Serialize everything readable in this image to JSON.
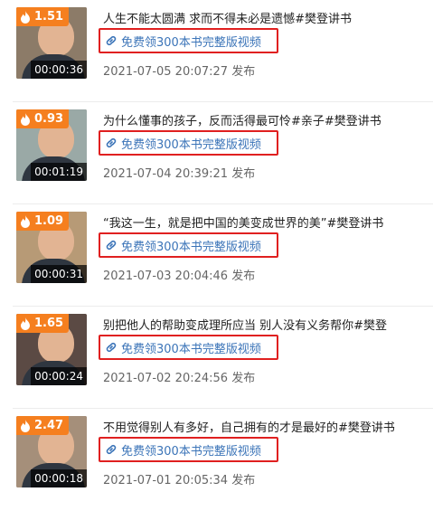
{
  "items": [
    {
      "heat": "1.51",
      "duration": "00:00:36",
      "title": "人生不能太圆满 求而不得未必是遗憾#樊登讲书",
      "link": "免费领300本书完整版视频",
      "date": "2021-07-05 20:07:27 发布",
      "thumb_color": "#8c7b68"
    },
    {
      "heat": "0.93",
      "duration": "00:01:19",
      "title": "为什么懂事的孩子，反而活得最可怜#亲子#樊登讲书",
      "link": "免费领300本书完整版视频",
      "date": "2021-07-04 20:39:21 发布",
      "thumb_color": "#9aa9a6"
    },
    {
      "heat": "1.09",
      "duration": "00:00:31",
      "title": "“我这一生，就是把中国的美变成世界的美”#樊登讲书",
      "link": "免费领300本书完整版视频",
      "date": "2021-07-03 20:04:46 发布",
      "thumb_color": "#b79a76"
    },
    {
      "heat": "1.65",
      "duration": "00:00:24",
      "title": "别把他人的帮助变成理所应当 别人没有义务帮你#樊登",
      "link": "免费领300本书完整版视频",
      "date": "2021-07-02 20:24:56 发布",
      "thumb_color": "#5b4a44"
    },
    {
      "heat": "2.47",
      "duration": "00:00:18",
      "title": "不用觉得别人有多好，自己拥有的才是最好的#樊登讲书",
      "link": "免费领300本书完整版视频",
      "date": "2021-07-01 20:05:34 发布",
      "thumb_color": "#a58f7a"
    }
  ],
  "colors": {
    "badge": "#f57f1f",
    "link": "#3b74b8",
    "highlight_border": "#e02020"
  },
  "icons": {
    "badge": "flame-icon",
    "link": "chain-link-icon"
  }
}
